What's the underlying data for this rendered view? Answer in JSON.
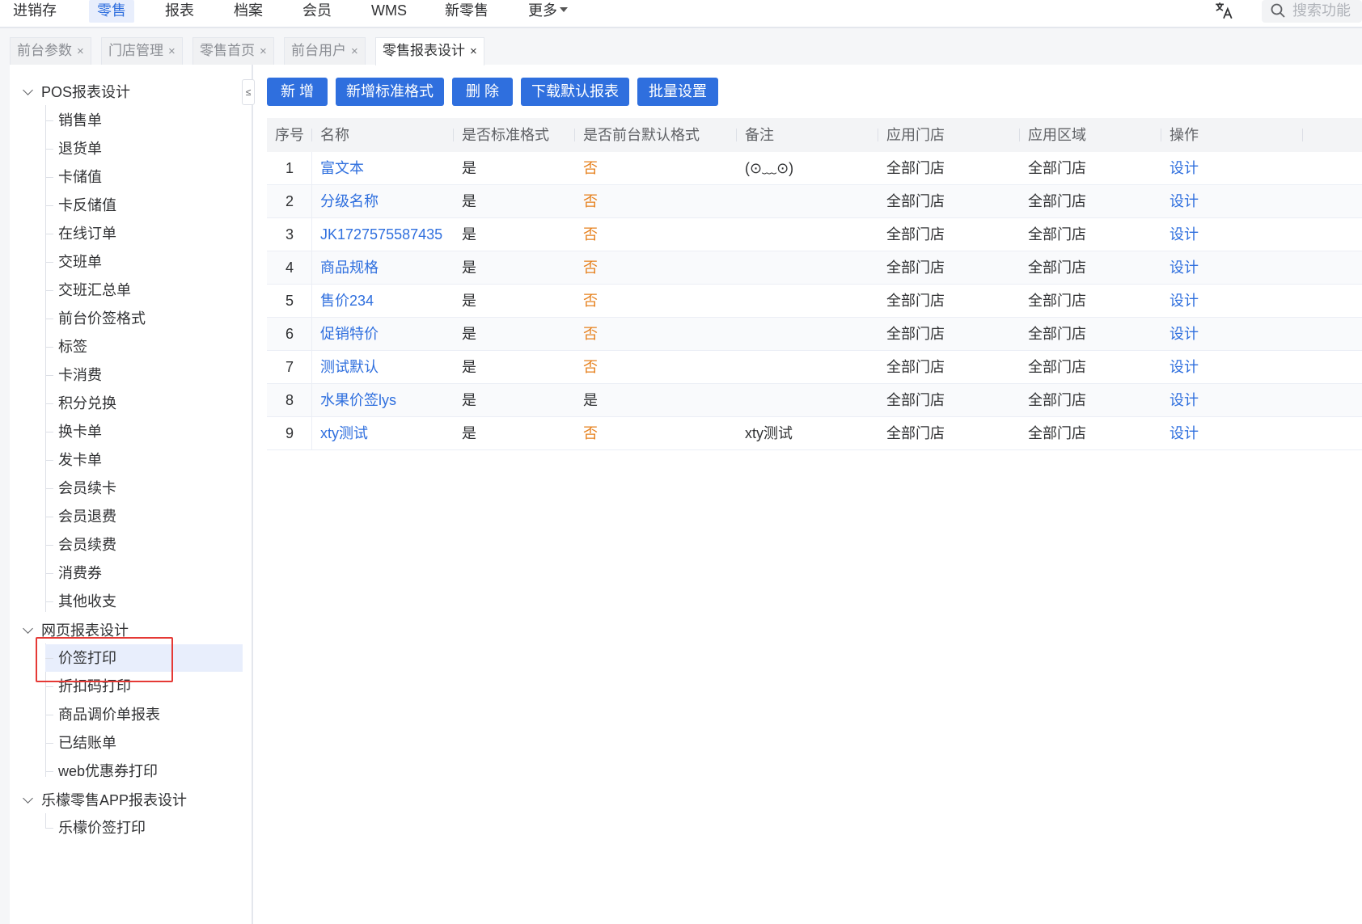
{
  "topnav": {
    "items": [
      {
        "label": "进销存",
        "active": false
      },
      {
        "label": "零售",
        "active": true
      },
      {
        "label": "报表",
        "active": false
      },
      {
        "label": "档案",
        "active": false
      },
      {
        "label": "会员",
        "active": false
      },
      {
        "label": "WMS",
        "active": false
      },
      {
        "label": "新零售",
        "active": false
      },
      {
        "label": "更多",
        "active": false
      }
    ],
    "translate_icon": "translate-icon",
    "search_placeholder": "搜索功能"
  },
  "tabs": [
    {
      "label": "前台参数",
      "close": "×"
    },
    {
      "label": "门店管理",
      "close": "×"
    },
    {
      "label": "零售首页",
      "close": "×"
    },
    {
      "label": "前台用户",
      "close": "×"
    },
    {
      "label": "零售报表设计",
      "close": "×"
    }
  ],
  "sidebar": {
    "collapse_icon": "≤",
    "groups": [
      {
        "label": "POS报表设计",
        "items": [
          "销售单",
          "退货单",
          "卡储值",
          "卡反储值",
          "在线订单",
          "交班单",
          "交班汇总单",
          "前台价签格式",
          "标签",
          "卡消费",
          "积分兑换",
          "换卡单",
          "发卡单",
          "会员续卡",
          "会员退费",
          "会员续费",
          "消费券",
          "其他收支"
        ]
      },
      {
        "label": "网页报表设计",
        "items": [
          "价签打印",
          "折扣码打印",
          "商品调价单报表",
          "已结账单",
          "web优惠券打印"
        ],
        "selected": "价签打印"
      },
      {
        "label": "乐檬零售APP报表设计",
        "items": [
          "乐檬价签打印"
        ]
      }
    ]
  },
  "toolbar": {
    "add": "新 增",
    "add_standard": "新增标准格式",
    "delete": "删 除",
    "download_default": "下载默认报表",
    "batch_settings": "批量设置"
  },
  "table": {
    "headers": [
      "序号",
      "名称",
      "是否标准格式",
      "是否前台默认格式",
      "备注",
      "应用门店",
      "应用区域",
      "操作"
    ],
    "rows": [
      {
        "seq": "1",
        "name": "富文本",
        "standard": "是",
        "default": "否",
        "note": "(⊙﹏⊙)",
        "store": "全部门店",
        "area": "全部门店",
        "action": "设计"
      },
      {
        "seq": "2",
        "name": "分级名称",
        "standard": "是",
        "default": "否",
        "note": "",
        "store": "全部门店",
        "area": "全部门店",
        "action": "设计"
      },
      {
        "seq": "3",
        "name": "JK1727575587435",
        "standard": "是",
        "default": "否",
        "note": "",
        "store": "全部门店",
        "area": "全部门店",
        "action": "设计"
      },
      {
        "seq": "4",
        "name": "商品规格",
        "standard": "是",
        "default": "否",
        "note": "",
        "store": "全部门店",
        "area": "全部门店",
        "action": "设计"
      },
      {
        "seq": "5",
        "name": "售价234",
        "standard": "是",
        "default": "否",
        "note": "",
        "store": "全部门店",
        "area": "全部门店",
        "action": "设计"
      },
      {
        "seq": "6",
        "name": "促销特价",
        "standard": "是",
        "default": "否",
        "note": "",
        "store": "全部门店",
        "area": "全部门店",
        "action": "设计"
      },
      {
        "seq": "7",
        "name": "测试默认",
        "standard": "是",
        "default": "否",
        "note": "",
        "store": "全部门店",
        "area": "全部门店",
        "action": "设计"
      },
      {
        "seq": "8",
        "name": "水果价签lys",
        "standard": "是",
        "default": "是",
        "note": "",
        "store": "全部门店",
        "area": "全部门店",
        "action": "设计"
      },
      {
        "seq": "9",
        "name": "xty测试",
        "standard": "是",
        "default": "否",
        "note": "xty测试",
        "store": "全部门店",
        "area": "全部门店",
        "action": "设计"
      }
    ]
  },
  "colors": {
    "primary": "#2f6fde",
    "no_value": "#e6801d",
    "highlight": "#e53935"
  }
}
